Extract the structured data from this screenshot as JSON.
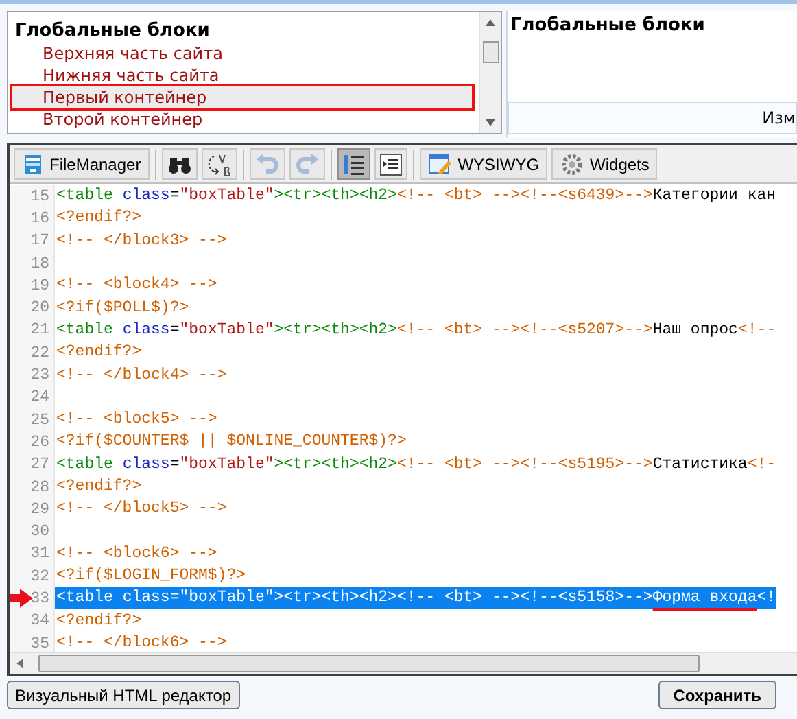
{
  "blocks_list": {
    "group": "Глобальные блоки",
    "items": [
      {
        "label": "Верхняя часть сайта",
        "selected": false,
        "highlighted": false
      },
      {
        "label": "Нижняя часть сайта",
        "selected": false,
        "highlighted": false
      },
      {
        "label": "Первый контейнер",
        "selected": true,
        "highlighted": true
      },
      {
        "label": "Второй контейнер",
        "selected": false,
        "highlighted": false
      }
    ]
  },
  "detail_panel": {
    "title": "Глобальные блоки",
    "field_text": "Изм"
  },
  "toolbar": [
    {
      "kind": "filemanager",
      "label": "FileManager",
      "disabled": false,
      "pressed": false
    },
    {
      "kind": "find",
      "disabled": false,
      "pressed": false
    },
    {
      "kind": "replace",
      "disabled": false,
      "pressed": false
    },
    {
      "kind": "undo",
      "disabled": true,
      "pressed": false
    },
    {
      "kind": "redo",
      "disabled": true,
      "pressed": false
    },
    {
      "kind": "line_numbers",
      "disabled": false,
      "pressed": true
    },
    {
      "kind": "indent",
      "disabled": false,
      "pressed": false
    },
    {
      "kind": "wysiwyg",
      "label": "WYSIWYG",
      "disabled": false,
      "pressed": false
    },
    {
      "kind": "widgets",
      "label": "Widgets",
      "disabled": false,
      "pressed": false
    }
  ],
  "code_lines": [
    {
      "number": "15",
      "selected": false,
      "arrow": false,
      "tokens": [
        {
          "kind": "tag",
          "text": "<table "
        },
        {
          "kind": "attr",
          "text": "class"
        },
        {
          "kind": "plain",
          "text": "="
        },
        {
          "kind": "str",
          "text": "\"boxTable\""
        },
        {
          "kind": "tag",
          "text": "><tr><th><h2>"
        },
        {
          "kind": "comment",
          "text": "<!-- <bt> --><!--<s6439>-->"
        },
        {
          "kind": "text",
          "text": "Категории кан",
          "underlined": false
        }
      ]
    },
    {
      "number": "16",
      "selected": false,
      "arrow": false,
      "tokens": [
        {
          "kind": "comment",
          "text": "<?endif?>"
        }
      ]
    },
    {
      "number": "17",
      "selected": false,
      "arrow": false,
      "tokens": [
        {
          "kind": "comment",
          "text": "<!-- </block3> -->"
        }
      ]
    },
    {
      "number": "18",
      "selected": false,
      "arrow": false
    },
    {
      "number": "19",
      "selected": false,
      "arrow": false,
      "tokens": [
        {
          "kind": "comment",
          "text": "<!-- <block4> -->"
        }
      ]
    },
    {
      "number": "20",
      "selected": false,
      "arrow": false,
      "tokens": [
        {
          "kind": "comment",
          "text": "<?if($POLL$)?>"
        }
      ]
    },
    {
      "number": "21",
      "selected": false,
      "arrow": false,
      "tokens": [
        {
          "kind": "tag",
          "text": "<table "
        },
        {
          "kind": "attr",
          "text": "class"
        },
        {
          "kind": "plain",
          "text": "="
        },
        {
          "kind": "str",
          "text": "\"boxTable\""
        },
        {
          "kind": "tag",
          "text": "><tr><th><h2>"
        },
        {
          "kind": "comment",
          "text": "<!-- <bt> --><!--<s5207>-->"
        },
        {
          "kind": "text",
          "text": "Наш опрос",
          "underlined": false
        },
        {
          "kind": "comment",
          "text": "<!--"
        }
      ]
    },
    {
      "number": "22",
      "selected": false,
      "arrow": false,
      "tokens": [
        {
          "kind": "comment",
          "text": "<?endif?>"
        }
      ]
    },
    {
      "number": "23",
      "selected": false,
      "arrow": false,
      "tokens": [
        {
          "kind": "comment",
          "text": "<!-- </block4> -->"
        }
      ]
    },
    {
      "number": "24",
      "selected": false,
      "arrow": false
    },
    {
      "number": "25",
      "selected": false,
      "arrow": false,
      "tokens": [
        {
          "kind": "comment",
          "text": "<!-- <block5> -->"
        }
      ]
    },
    {
      "number": "26",
      "selected": false,
      "arrow": false,
      "tokens": [
        {
          "kind": "comment",
          "text": "<?if($COUNTER$ || $ONLINE_COUNTER$)?>"
        }
      ]
    },
    {
      "number": "27",
      "selected": false,
      "arrow": false,
      "tokens": [
        {
          "kind": "tag",
          "text": "<table "
        },
        {
          "kind": "attr",
          "text": "class"
        },
        {
          "kind": "plain",
          "text": "="
        },
        {
          "kind": "str",
          "text": "\"boxTable\""
        },
        {
          "kind": "tag",
          "text": "><tr><th><h2>"
        },
        {
          "kind": "comment",
          "text": "<!-- <bt> --><!--<s5195>-->"
        },
        {
          "kind": "text",
          "text": "Статистика",
          "underlined": false
        },
        {
          "kind": "comment",
          "text": "<!-"
        }
      ]
    },
    {
      "number": "28",
      "selected": false,
      "arrow": false,
      "tokens": [
        {
          "kind": "comment",
          "text": "<?endif?>"
        }
      ]
    },
    {
      "number": "29",
      "selected": false,
      "arrow": false,
      "tokens": [
        {
          "kind": "comment",
          "text": "<!-- </block5> -->"
        }
      ]
    },
    {
      "number": "30",
      "selected": false,
      "arrow": false
    },
    {
      "number": "31",
      "selected": false,
      "arrow": false,
      "tokens": [
        {
          "kind": "comment",
          "text": "<!-- <block6> -->"
        }
      ]
    },
    {
      "number": "32",
      "selected": false,
      "arrow": false,
      "tokens": [
        {
          "kind": "comment",
          "text": "<?if($LOGIN_FORM$)?>"
        }
      ]
    },
    {
      "number": "33",
      "selected": true,
      "arrow": true,
      "tokens": [
        {
          "kind": "tag",
          "text": "<table "
        },
        {
          "kind": "attr",
          "text": "class"
        },
        {
          "kind": "plain",
          "text": "="
        },
        {
          "kind": "str",
          "text": "\"boxTable\""
        },
        {
          "kind": "tag",
          "text": "><tr><th><h2>"
        },
        {
          "kind": "comment",
          "text": "<!-- <bt> --><!--<s5158>-->"
        },
        {
          "kind": "text",
          "text": "Форма входа",
          "underlined": true
        },
        {
          "kind": "comment",
          "text": "<!"
        }
      ]
    },
    {
      "number": "34",
      "selected": false,
      "arrow": false,
      "tokens": [
        {
          "kind": "comment",
          "text": "<?endif?>"
        }
      ]
    },
    {
      "number": "35",
      "selected": false,
      "arrow": false,
      "tokens": [
        {
          "kind": "comment",
          "text": "<!-- </block6> -->"
        }
      ]
    }
  ],
  "buttons": [
    {
      "kind": "visual",
      "label": "Визуальный HTML редактор"
    },
    {
      "kind": "save",
      "label": "Сохранить"
    }
  ]
}
